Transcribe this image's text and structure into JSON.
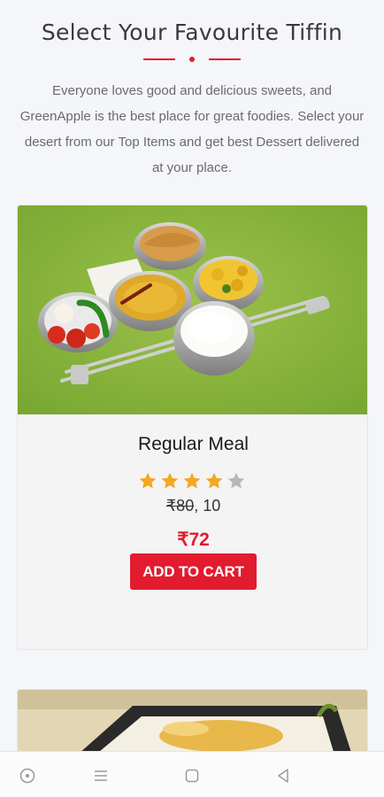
{
  "section": {
    "title": "Select Your Favourite Tiffin",
    "intro": "Everyone loves good and delicious sweets, and GreenApple is the best place for great foodies. Select your desert from our Top Items and get best Dessert delivered at your place."
  },
  "product": {
    "name": "Regular Meal",
    "rating": 4,
    "rating_max": 5,
    "old_price": "₹80",
    "discount_text": ", 10",
    "price": "₹72",
    "cta_label": "ADD TO CART"
  },
  "colors": {
    "accent": "#e21b2e",
    "star_on": "#f5a623",
    "star_off": "#b8b8b8"
  },
  "nav": {
    "icons": [
      "record-icon",
      "menu-icon",
      "home-square-icon",
      "back-triangle-icon"
    ]
  }
}
